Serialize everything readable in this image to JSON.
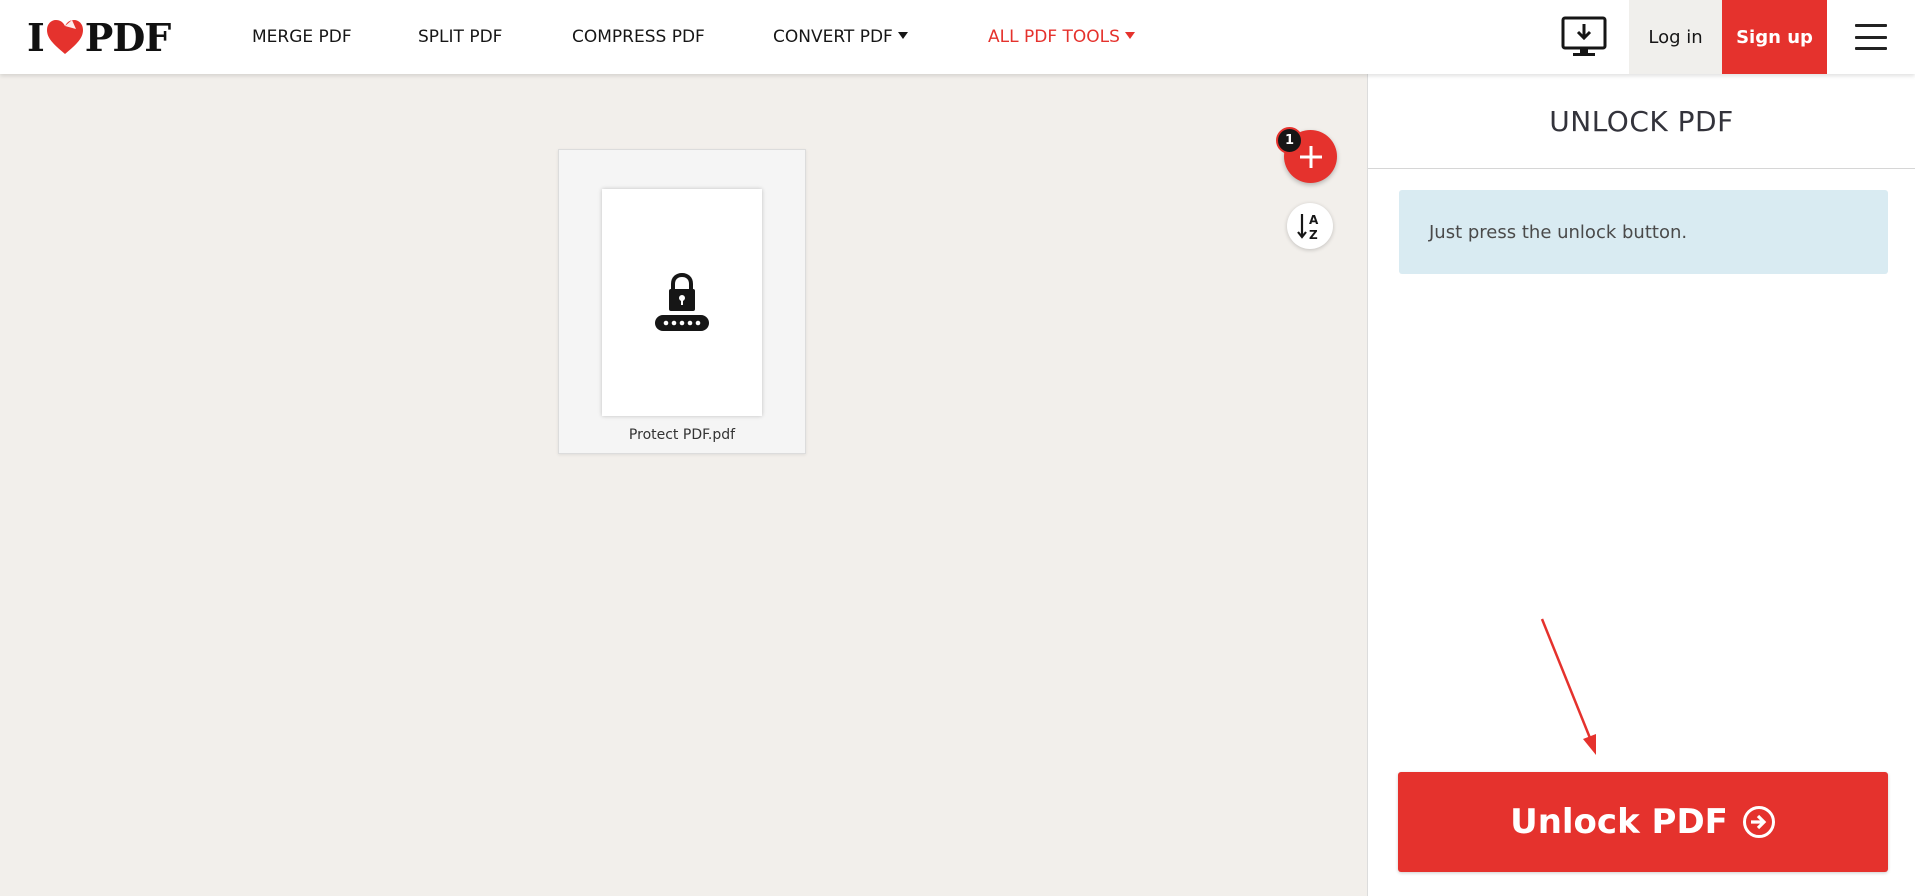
{
  "header": {
    "logo_text_left": "I",
    "logo_text_right": "PDF",
    "nav": [
      {
        "label": "MERGE PDF",
        "dropdown": false
      },
      {
        "label": "SPLIT PDF",
        "dropdown": false
      },
      {
        "label": "COMPRESS PDF",
        "dropdown": false
      },
      {
        "label": "CONVERT PDF",
        "dropdown": true
      },
      {
        "label": "ALL PDF TOOLS",
        "dropdown": true
      }
    ],
    "login_label": "Log in",
    "signup_label": "Sign up",
    "desktop_icon": "desktop-download-icon",
    "menu_icon": "hamburger-icon"
  },
  "workarea": {
    "files": [
      {
        "name": "Protect PDF.pdf",
        "thumbnail_icon": "lock-password-icon"
      }
    ],
    "file_count": "1",
    "add_icon": "plus-icon",
    "sort_icon": "sort-az-icon"
  },
  "sidebar": {
    "title": "UNLOCK PDF",
    "info": "Just press the unlock button.",
    "action_label": "Unlock PDF",
    "action_icon": "arrow-circle-right-icon"
  },
  "colors": {
    "brand_red": "#e5322d",
    "work_bg": "#f2efeb",
    "info_bg": "#d9ebf2"
  }
}
